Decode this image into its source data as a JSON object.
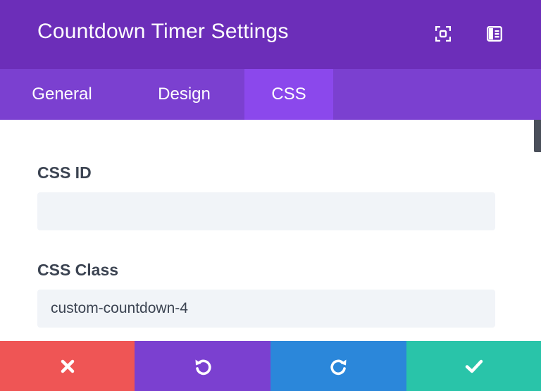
{
  "header": {
    "title": "Countdown Timer Settings",
    "icons": [
      "expand-icon",
      "sidebar-layout-icon"
    ]
  },
  "tabs": [
    {
      "label": "General",
      "active": false
    },
    {
      "label": "Design",
      "active": false
    },
    {
      "label": "CSS",
      "active": true
    }
  ],
  "fields": {
    "css_id": {
      "label": "CSS ID",
      "value": "",
      "placeholder": ""
    },
    "css_class": {
      "label": "CSS Class",
      "value": "custom-countdown-4",
      "placeholder": ""
    }
  },
  "footer": {
    "buttons": [
      {
        "name": "discard",
        "icon": "close-icon",
        "color": "#ef5555"
      },
      {
        "name": "undo",
        "icon": "undo-icon",
        "color": "#7b40d0"
      },
      {
        "name": "redo",
        "icon": "redo-icon",
        "color": "#2b87da"
      },
      {
        "name": "save",
        "icon": "checkmark-icon",
        "color": "#29c4a9"
      }
    ]
  },
  "colors": {
    "header_bg": "#6c2eb9",
    "tabs_bg": "#7b40d0",
    "active_tab_bg": "#8b48ec",
    "input_bg": "#f1f4f8",
    "label_text": "#3c4452"
  }
}
